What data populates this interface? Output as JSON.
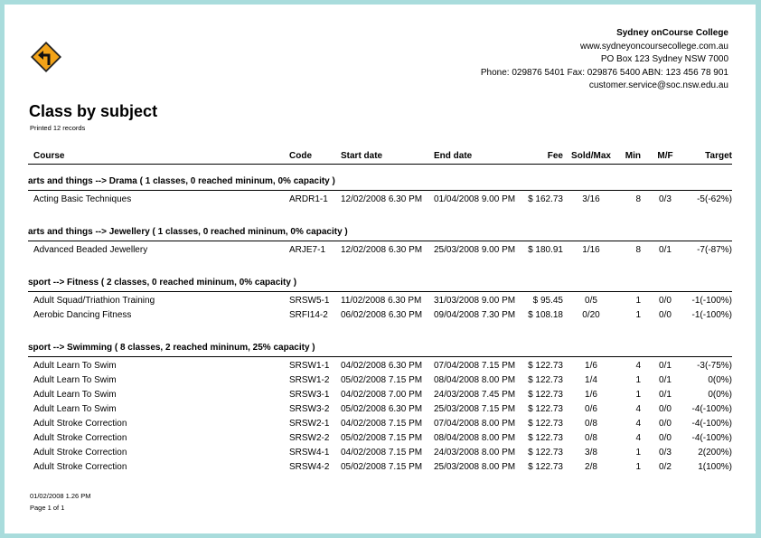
{
  "college": {
    "name": "Sydney onCourse College",
    "website": "www.sydneyoncoursecollege.com.au",
    "address": "PO Box 123 Sydney NSW 7000",
    "phone_line": "Phone: 029876 5401 Fax: 029876 5400 ABN: 123 456 78 901",
    "email": "customer.service@soc.nsw.edu.au"
  },
  "report": {
    "title": "Class by subject",
    "printed": "Printed 12 records"
  },
  "columns": {
    "course": "Course",
    "code": "Code",
    "start": "Start date",
    "end": "End date",
    "fee": "Fee",
    "sold": "Sold/Max",
    "min": "Min",
    "mf": "M/F",
    "target": "Target"
  },
  "groups": [
    {
      "title": "arts and things --> Drama ( 1 classes, 0 reached mininum, 0% capacity )",
      "rows": [
        {
          "course": "Acting Basic Techniques",
          "code": "ARDR1-1",
          "start": "12/02/2008 6.30 PM",
          "end": "01/04/2008 9.00 PM",
          "fee": "$ 162.73",
          "sold": "3/16",
          "min": "8",
          "mf": "0/3",
          "target": "-5(-62%)"
        }
      ]
    },
    {
      "title": "arts and things --> Jewellery ( 1 classes, 0 reached mininum, 0% capacity )",
      "rows": [
        {
          "course": "Advanced Beaded Jewellery",
          "code": "ARJE7-1",
          "start": "12/02/2008 6.30 PM",
          "end": "25/03/2008 9.00 PM",
          "fee": "$ 180.91",
          "sold": "1/16",
          "min": "8",
          "mf": "0/1",
          "target": "-7(-87%)"
        }
      ]
    },
    {
      "title": "sport --> Fitness ( 2 classes, 0 reached mininum, 0% capacity )",
      "rows": [
        {
          "course": "Adult Squad/Triathion Training",
          "code": "SRSW5-1",
          "start": "11/02/2008 6.30 PM",
          "end": "31/03/2008 9.00 PM",
          "fee": "$ 95.45",
          "sold": "0/5",
          "min": "1",
          "mf": "0/0",
          "target": "-1(-100%)"
        },
        {
          "course": "Aerobic Dancing Fitness",
          "code": "SRFI14-2",
          "start": "06/02/2008 6.30 PM",
          "end": "09/04/2008 7.30 PM",
          "fee": "$ 108.18",
          "sold": "0/20",
          "min": "1",
          "mf": "0/0",
          "target": "-1(-100%)"
        }
      ]
    },
    {
      "title": "sport --> Swimming ( 8 classes, 2 reached mininum, 25% capacity )",
      "rows": [
        {
          "course": "Adult Learn To Swim",
          "code": "SRSW1-1",
          "start": "04/02/2008 6.30 PM",
          "end": "07/04/2008 7.15 PM",
          "fee": "$ 122.73",
          "sold": "1/6",
          "min": "4",
          "mf": "0/1",
          "target": "-3(-75%)"
        },
        {
          "course": "Adult Learn To Swim",
          "code": "SRSW1-2",
          "start": "05/02/2008 7.15 PM",
          "end": "08/04/2008 8.00 PM",
          "fee": "$ 122.73",
          "sold": "1/4",
          "min": "1",
          "mf": "0/1",
          "target": "0(0%)"
        },
        {
          "course": "Adult Learn To Swim",
          "code": "SRSW3-1",
          "start": "04/02/2008 7.00 PM",
          "end": "24/03/2008 7.45 PM",
          "fee": "$ 122.73",
          "sold": "1/6",
          "min": "1",
          "mf": "0/1",
          "target": "0(0%)"
        },
        {
          "course": "Adult Learn To Swim",
          "code": "SRSW3-2",
          "start": "05/02/2008 6.30 PM",
          "end": "25/03/2008 7.15 PM",
          "fee": "$ 122.73",
          "sold": "0/6",
          "min": "4",
          "mf": "0/0",
          "target": "-4(-100%)"
        },
        {
          "course": "Adult Stroke Correction",
          "code": "SRSW2-1",
          "start": "04/02/2008 7.15 PM",
          "end": "07/04/2008 8.00 PM",
          "fee": "$ 122.73",
          "sold": "0/8",
          "min": "4",
          "mf": "0/0",
          "target": "-4(-100%)"
        },
        {
          "course": "Adult Stroke Correction",
          "code": "SRSW2-2",
          "start": "05/02/2008 7.15 PM",
          "end": "08/04/2008 8.00 PM",
          "fee": "$ 122.73",
          "sold": "0/8",
          "min": "4",
          "mf": "0/0",
          "target": "-4(-100%)"
        },
        {
          "course": "Adult Stroke Correction",
          "code": "SRSW4-1",
          "start": "04/02/2008 7.15 PM",
          "end": "24/03/2008 8.00 PM",
          "fee": "$ 122.73",
          "sold": "3/8",
          "min": "1",
          "mf": "0/3",
          "target": "2(200%)"
        },
        {
          "course": "Adult Stroke Correction",
          "code": "SRSW4-2",
          "start": "05/02/2008 7.15 PM",
          "end": "25/03/2008 8.00 PM",
          "fee": "$ 122.73",
          "sold": "2/8",
          "min": "1",
          "mf": "0/2",
          "target": "1(100%)"
        }
      ]
    }
  ],
  "footer": {
    "timestamp": "01/02/2008 1.26 PM",
    "page": "Page 1 of 1"
  }
}
